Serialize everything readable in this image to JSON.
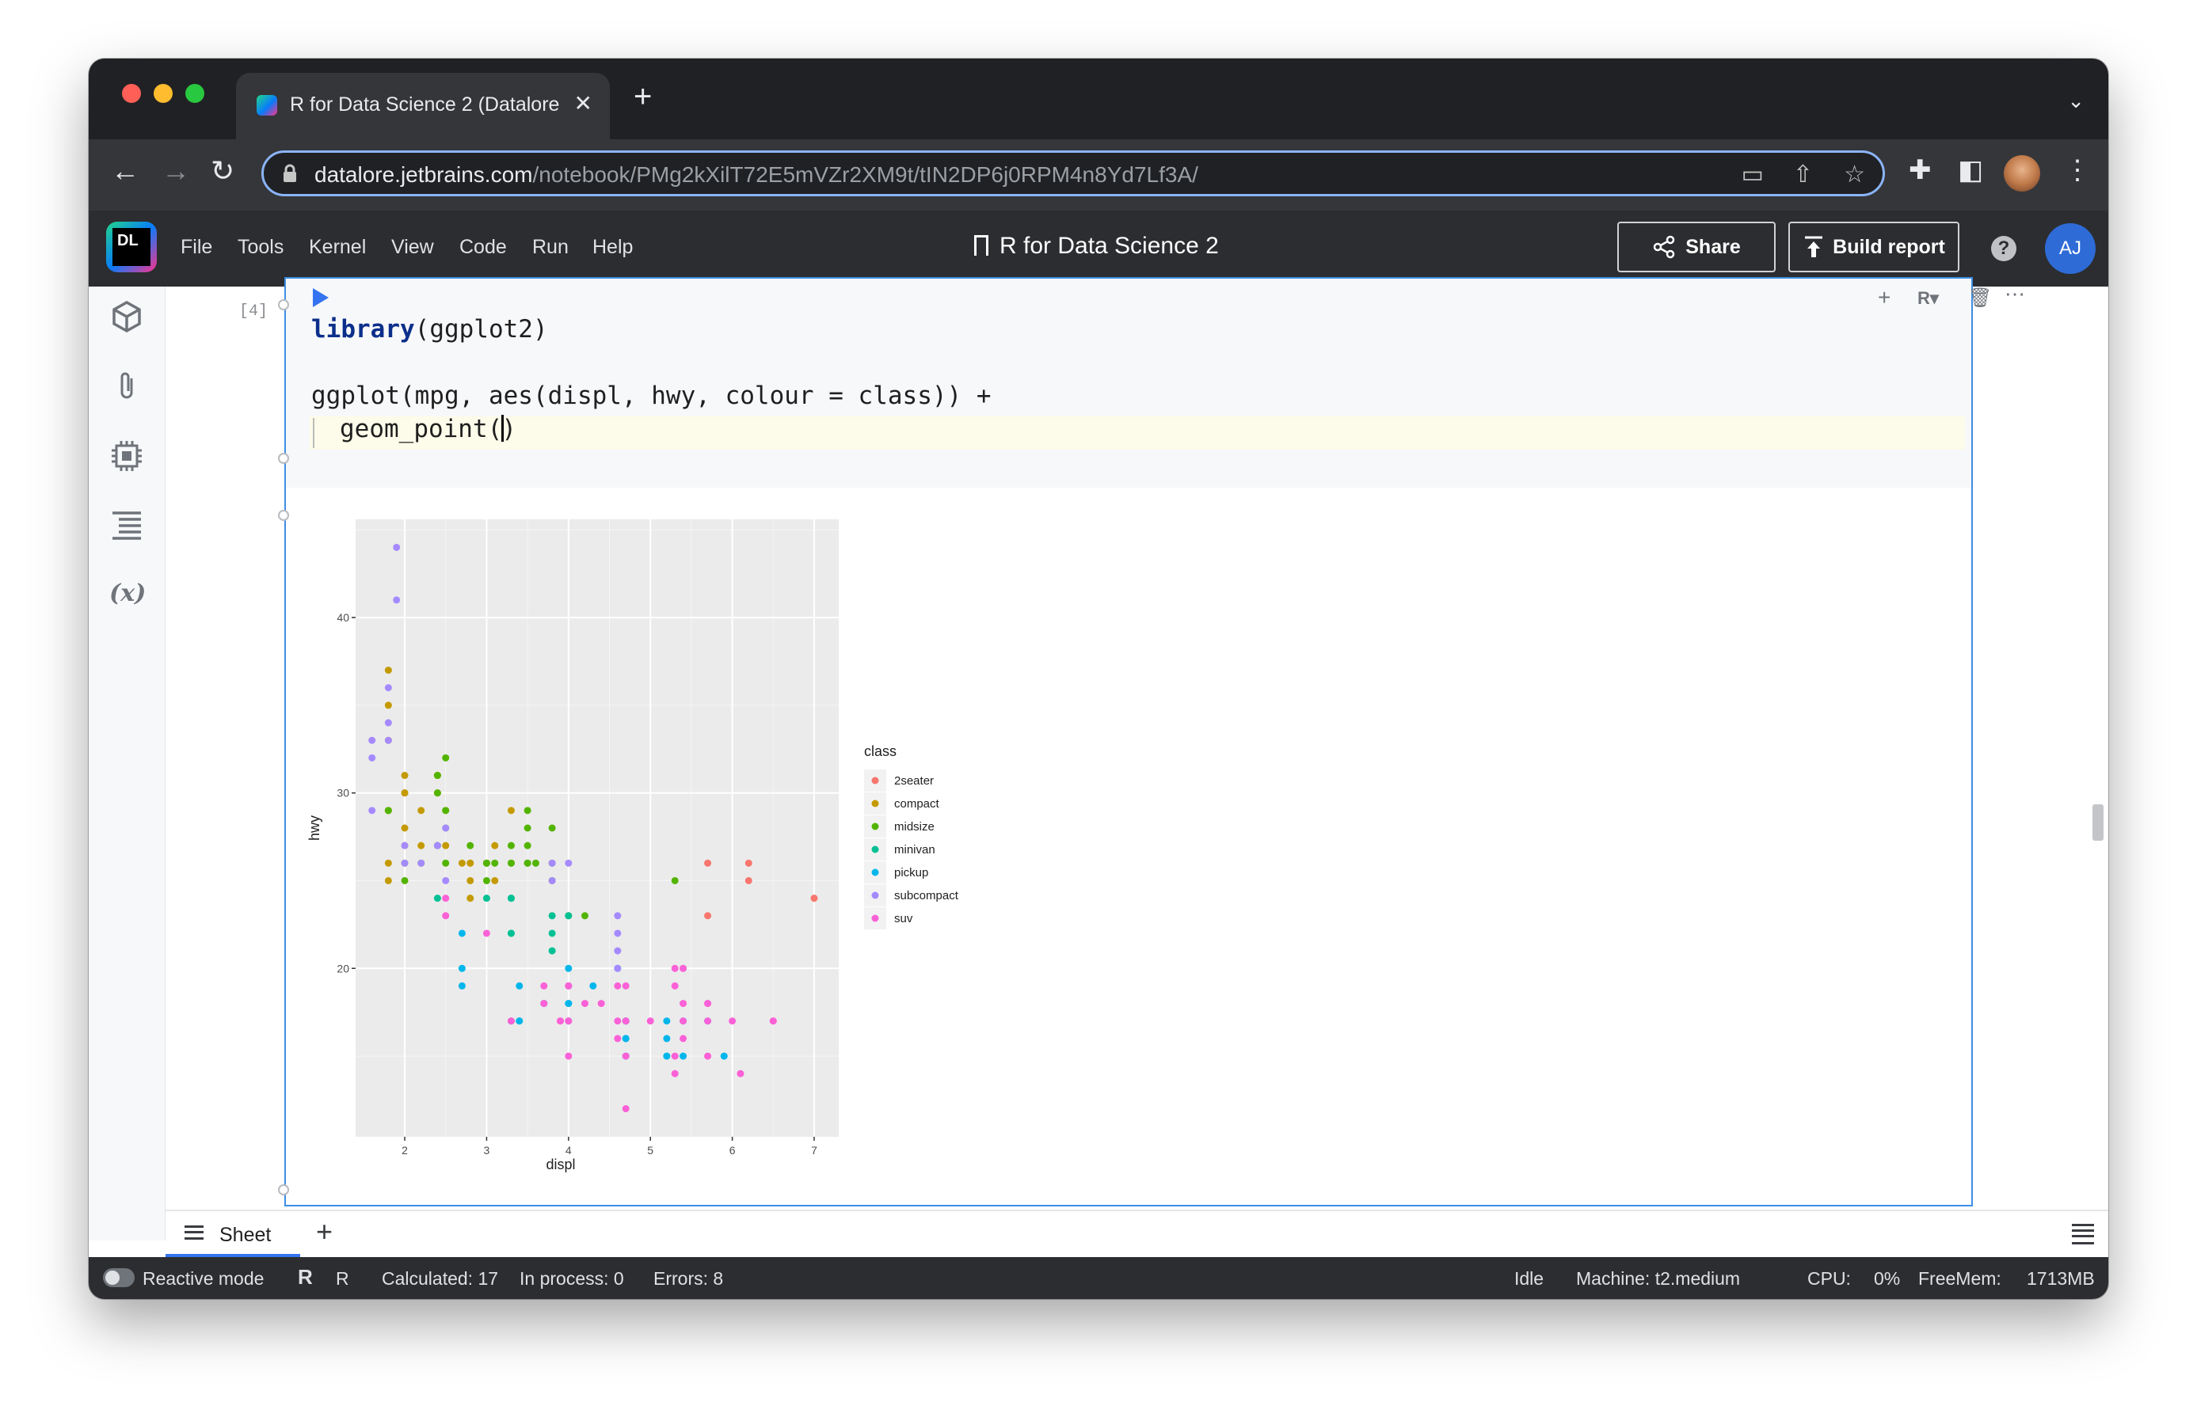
{
  "browser": {
    "tab_title": "R for Data Science 2 (Datalore",
    "url_host": "datalore.jetbrains.com",
    "url_path": "/notebook/PMg2kXilT72E5mVZr2XM9t/tIN2DP6j0RPM4n8Yd7Lf3A/"
  },
  "header": {
    "logo_text": "DL",
    "menu": [
      "File",
      "Tools",
      "Kernel",
      "View",
      "Code",
      "Run",
      "Help"
    ],
    "notebook_title": "R for Data Science 2",
    "share_label": "Share",
    "build_report_label": "Build report",
    "help_label": "?",
    "avatar_initials": "AJ"
  },
  "sidebar": {
    "icons": [
      "packages-icon",
      "attachments-icon",
      "environment-icon",
      "outline-icon",
      "variables-icon"
    ],
    "variables_label": "(x)",
    "more_label": "•••"
  },
  "cell": {
    "exec_count": "[4]",
    "code": {
      "line1_keyword": "library",
      "line1_rest": "(ggplot2)",
      "line3": "ggplot(mpg, aes(displ, hwy, colour = class)) +",
      "line4_before_cursor": "geom_point(",
      "line4_after_cursor": ")"
    }
  },
  "chart_data": {
    "type": "scatter",
    "xlabel": "displ",
    "ylabel": "hwy",
    "xlim": [
      1.4,
      7.3
    ],
    "ylim": [
      10.4,
      45.6
    ],
    "xticks": [
      2,
      3,
      4,
      5,
      6,
      7
    ],
    "yticks": [
      20,
      30,
      40
    ],
    "grid": true,
    "legend_title": "class",
    "legend_position": "right",
    "series": [
      {
        "name": "2seater",
        "color": "#F8766D",
        "points": [
          [
            5.7,
            26
          ],
          [
            5.7,
            23
          ],
          [
            6.2,
            26
          ],
          [
            6.2,
            25
          ],
          [
            7.0,
            24
          ]
        ]
      },
      {
        "name": "compact",
        "color": "#C49A00",
        "points": [
          [
            1.8,
            29
          ],
          [
            1.8,
            29
          ],
          [
            2.0,
            31
          ],
          [
            2.0,
            30
          ],
          [
            2.8,
            26
          ],
          [
            2.8,
            26
          ],
          [
            3.1,
            27
          ],
          [
            1.8,
            26
          ],
          [
            1.8,
            25
          ],
          [
            2.0,
            28
          ],
          [
            2.0,
            27
          ],
          [
            2.8,
            25
          ],
          [
            3.1,
            25
          ],
          [
            2.2,
            27
          ],
          [
            2.2,
            29
          ],
          [
            2.4,
            31
          ],
          [
            2.4,
            31
          ],
          [
            3.0,
            26
          ],
          [
            3.3,
            26
          ],
          [
            1.8,
            33
          ],
          [
            1.8,
            37
          ],
          [
            1.8,
            35
          ],
          [
            2.5,
            27
          ],
          [
            2.5,
            29
          ],
          [
            2.0,
            30
          ],
          [
            2.8,
            24
          ],
          [
            2.4,
            30
          ],
          [
            3.0,
            26
          ],
          [
            3.3,
            29
          ],
          [
            2.7,
            26
          ]
        ]
      },
      {
        "name": "midsize",
        "color": "#53B400",
        "points": [
          [
            2.4,
            27
          ],
          [
            2.4,
            30
          ],
          [
            3.1,
            26
          ],
          [
            3.5,
            29
          ],
          [
            3.6,
            26
          ],
          [
            2.2,
            26
          ],
          [
            2.4,
            27
          ],
          [
            2.5,
            26
          ],
          [
            2.5,
            28
          ],
          [
            3.0,
            26
          ],
          [
            3.5,
            28
          ],
          [
            3.3,
            26
          ],
          [
            3.8,
            26
          ],
          [
            3.8,
            28
          ],
          [
            2.5,
            29
          ],
          [
            2.5,
            32
          ],
          [
            3.5,
            26
          ],
          [
            3.5,
            27
          ],
          [
            3.0,
            25
          ],
          [
            3.3,
            27
          ],
          [
            2.4,
            31
          ],
          [
            3.0,
            26
          ],
          [
            3.5,
            26
          ],
          [
            3.8,
            25
          ],
          [
            2.8,
            27
          ],
          [
            1.8,
            29
          ],
          [
            2.0,
            26
          ],
          [
            2.0,
            25
          ],
          [
            4.2,
            23
          ],
          [
            4.0,
            23
          ],
          [
            5.3,
            25
          ]
        ]
      },
      {
        "name": "minivan",
        "color": "#00C094",
        "points": [
          [
            2.4,
            24
          ],
          [
            3.0,
            24
          ],
          [
            3.3,
            22
          ],
          [
            3.3,
            22
          ],
          [
            3.3,
            24
          ],
          [
            3.3,
            24
          ],
          [
            3.3,
            17
          ],
          [
            3.8,
            22
          ],
          [
            3.8,
            21
          ],
          [
            3.8,
            23
          ],
          [
            4.0,
            23
          ]
        ]
      },
      {
        "name": "pickup",
        "color": "#00B6EB",
        "points": [
          [
            2.7,
            20
          ],
          [
            2.7,
            19
          ],
          [
            3.4,
            17
          ],
          [
            3.4,
            17
          ],
          [
            4.0,
            18
          ],
          [
            4.0,
            17
          ],
          [
            4.7,
            16
          ],
          [
            4.7,
            17
          ],
          [
            4.7,
            15
          ],
          [
            5.2,
            17
          ],
          [
            5.2,
            15
          ],
          [
            5.7,
            17
          ],
          [
            5.9,
            15
          ],
          [
            3.4,
            19
          ],
          [
            4.0,
            20
          ],
          [
            4.0,
            18
          ],
          [
            4.7,
            17
          ],
          [
            4.7,
            16
          ],
          [
            4.7,
            17
          ],
          [
            5.2,
            16
          ],
          [
            5.4,
            17
          ],
          [
            5.4,
            15
          ],
          [
            4.3,
            19
          ],
          [
            4.6,
            20
          ],
          [
            2.7,
            22
          ],
          [
            4.0,
            19
          ],
          [
            3.7,
            18
          ]
        ]
      },
      {
        "name": "subcompact",
        "color": "#A58AFF",
        "points": [
          [
            1.9,
            44
          ],
          [
            1.9,
            41
          ],
          [
            1.6,
            33
          ],
          [
            1.6,
            32
          ],
          [
            1.6,
            29
          ],
          [
            1.8,
            34
          ],
          [
            1.8,
            36
          ],
          [
            2.0,
            27
          ],
          [
            2.0,
            26
          ],
          [
            2.4,
            27
          ],
          [
            2.5,
            25
          ],
          [
            2.2,
            26
          ],
          [
            2.5,
            28
          ],
          [
            3.8,
            26
          ],
          [
            3.8,
            25
          ],
          [
            4.0,
            26
          ],
          [
            4.6,
            23
          ],
          [
            4.6,
            22
          ],
          [
            4.6,
            21
          ],
          [
            5.4,
            20
          ],
          [
            4.6,
            20
          ],
          [
            1.8,
            33
          ]
        ]
      },
      {
        "name": "suv",
        "color": "#FB61D7",
        "points": [
          [
            5.7,
            17
          ],
          [
            5.7,
            18
          ],
          [
            6.5,
            17
          ],
          [
            6.1,
            14
          ],
          [
            5.3,
            15
          ],
          [
            5.3,
            20
          ],
          [
            5.3,
            19
          ],
          [
            5.7,
            18
          ],
          [
            6.0,
            17
          ],
          [
            4.7,
            17
          ],
          [
            4.7,
            12
          ],
          [
            4.7,
            19
          ],
          [
            4.7,
            15
          ],
          [
            4.0,
            17
          ],
          [
            4.2,
            18
          ],
          [
            4.4,
            18
          ],
          [
            4.6,
            19
          ],
          [
            5.4,
            18
          ],
          [
            5.4,
            20
          ],
          [
            5.4,
            17
          ],
          [
            4.0,
            19
          ],
          [
            3.9,
            17
          ],
          [
            4.0,
            15
          ],
          [
            5.4,
            16
          ],
          [
            4.0,
            17
          ],
          [
            4.6,
            16
          ],
          [
            5.0,
            17
          ],
          [
            5.3,
            14
          ],
          [
            2.5,
            23
          ],
          [
            2.5,
            24
          ],
          [
            3.7,
            19
          ],
          [
            3.9,
            17
          ],
          [
            4.7,
            17
          ],
          [
            5.7,
            15
          ],
          [
            3.0,
            22
          ],
          [
            3.3,
            17
          ],
          [
            4.6,
            17
          ],
          [
            3.7,
            18
          ],
          [
            4.0,
            19
          ],
          [
            6.5,
            17
          ]
        ]
      }
    ]
  },
  "sheets": {
    "tab_label": "Sheet",
    "add_label": "+"
  },
  "status": {
    "reactive_mode": "Reactive mode",
    "kernel_logo": "R",
    "language": "R",
    "calculated": "Calculated: 17",
    "in_process": "In process: 0",
    "errors": "Errors: 8",
    "state": "Idle",
    "machine": "Machine: t2.medium",
    "cpu_label": "CPU:",
    "cpu_value": "0%",
    "freemem_label": "FreeMem:",
    "freemem_value": "1713MB"
  }
}
